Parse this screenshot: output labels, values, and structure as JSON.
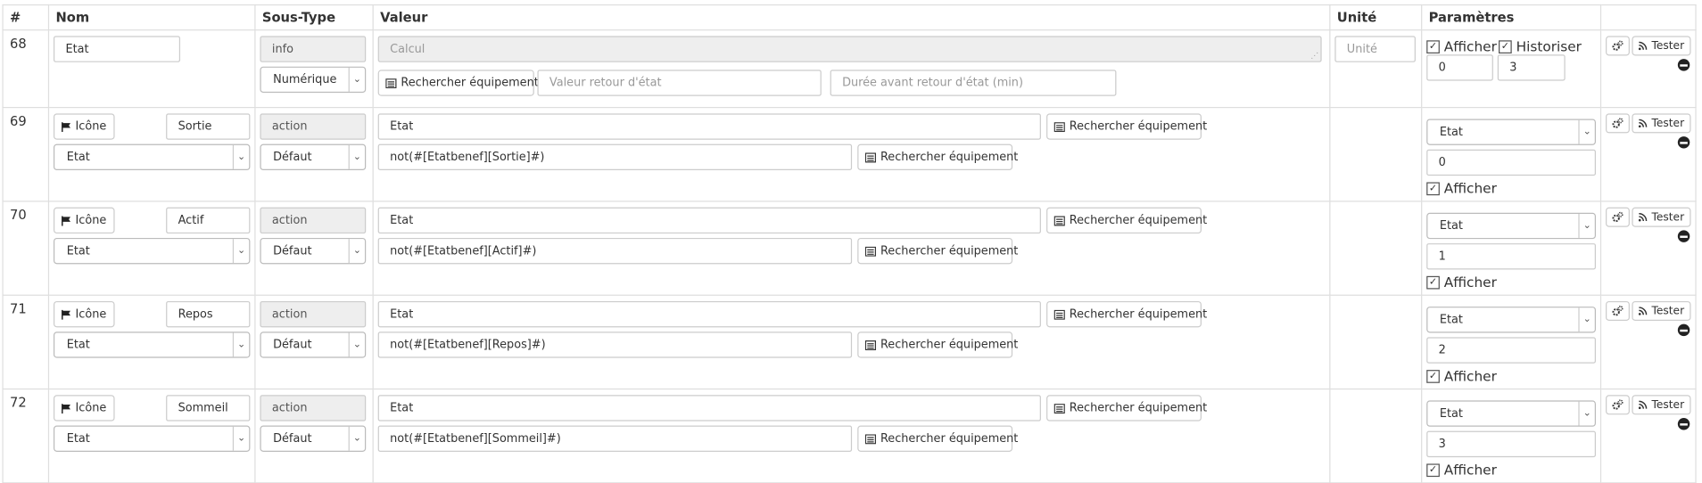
{
  "headers": {
    "num": "#",
    "nom": "Nom",
    "soustype": "Sous-Type",
    "valeur": "Valeur",
    "unite": "Unité",
    "parametres": "Paramètres"
  },
  "labels": {
    "rechercher": "Rechercher équipement",
    "icone": "Icône",
    "tester": "Tester",
    "afficher": "Afficher",
    "historiser": "Historiser"
  },
  "info_row": {
    "num": "68",
    "nom": "Etat",
    "type": "info",
    "subtype": "Numérique",
    "calcul_placeholder": "Calcul",
    "valeur_retour_placeholder": "Valeur retour d'état",
    "duree_placeholder": "Durée avant retour d'état (min)",
    "unite_placeholder": "Unité",
    "afficher_checked": true,
    "historiser_checked": true,
    "min": "0",
    "max": "3"
  },
  "action_rows": [
    {
      "num": "69",
      "nom": "Sortie",
      "type": "action",
      "subtype": "Défaut",
      "link": "Etat",
      "value": "Etat",
      "calcul": "not(#[Etatbenef][Sortie]#)",
      "param_select": "Etat",
      "param_value": "0",
      "afficher_checked": true
    },
    {
      "num": "70",
      "nom": "Actif",
      "type": "action",
      "subtype": "Défaut",
      "link": "Etat",
      "value": "Etat",
      "calcul": "not(#[Etatbenef][Actif]#)",
      "param_select": "Etat",
      "param_value": "1",
      "afficher_checked": true
    },
    {
      "num": "71",
      "nom": "Repos",
      "type": "action",
      "subtype": "Défaut",
      "link": "Etat",
      "value": "Etat",
      "calcul": "not(#[Etatbenef][Repos]#)",
      "param_select": "Etat",
      "param_value": "2",
      "afficher_checked": true
    },
    {
      "num": "72",
      "nom": "Sommeil",
      "type": "action",
      "subtype": "Défaut",
      "link": "Etat",
      "value": "Etat",
      "calcul": "not(#[Etatbenef][Sommeil]#)",
      "param_select": "Etat",
      "param_value": "3",
      "afficher_checked": true
    }
  ]
}
